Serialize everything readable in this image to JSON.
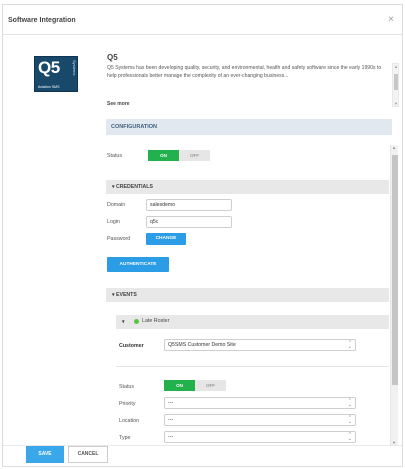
{
  "modal": {
    "title": "Software Integration",
    "close_glyph": "×"
  },
  "integration": {
    "logo_text": "Q5",
    "logo_side_text": "Systems",
    "logo_sub_text": "Aviation SMS",
    "name": "Q5",
    "description": "Q5 Systems has been developing quality, security, and environmental, health and safety software since the early 1990s to help professionals better manage the complexity of an ever-changing business...",
    "see_more": "See more"
  },
  "configuration": {
    "header": "CONFIGURATION",
    "status_label": "Status",
    "status_on": "ON",
    "status_off": "OFF",
    "status_value": "ON"
  },
  "credentials": {
    "header": "CREDENTIALS",
    "domain_label": "Domain",
    "domain_value": "salesdemo",
    "login_label": "Login",
    "login_value": "q5c",
    "password_label": "Password",
    "change_label": "CHANGE",
    "authenticate_label": "AUTHENTICATE"
  },
  "events": {
    "header": "EVENTS",
    "event_name": "Late Roster",
    "customer_label": "Customer",
    "customer_value": "Q5SMS Customer Demo Site",
    "status_label": "Status",
    "status_on": "ON",
    "status_off": "OFF",
    "priority_label": "Priority",
    "priority_value": "---",
    "location_label": "Location",
    "location_value": "---",
    "type_label": "Type",
    "type_value": "---"
  },
  "footer": {
    "save_label": "SAVE",
    "cancel_label": "CANCEL"
  },
  "colors": {
    "primary_blue": "#2b9de6",
    "toggle_on_green": "#22b14c",
    "logo_navy": "#18496b"
  },
  "icons": [
    "close-icon",
    "chevron-down-icon",
    "status-dot-icon",
    "select-caret-icon",
    "scroll-arrow-icon"
  ]
}
